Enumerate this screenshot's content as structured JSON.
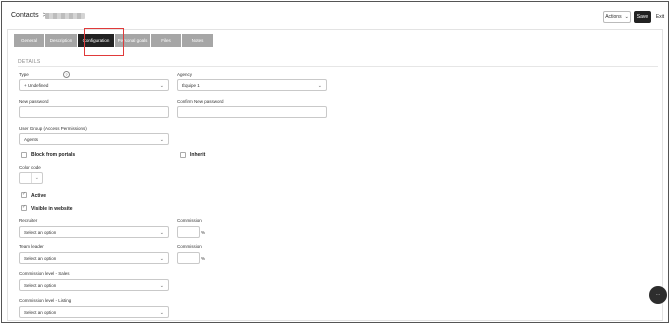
{
  "header": {
    "title": "Contacts",
    "separator": ">",
    "actions_label": "Actions",
    "save_label": "Save",
    "exit_label": "Exit"
  },
  "tabs": [
    {
      "label": "General"
    },
    {
      "label": "Description"
    },
    {
      "label": "Configuration",
      "active": true
    },
    {
      "label": "Personal goals"
    },
    {
      "label": "Files"
    },
    {
      "label": "Notes"
    }
  ],
  "section": {
    "title": "DETAILS"
  },
  "fields": {
    "type": {
      "label": "Type",
      "value": "+ Undefined"
    },
    "agency": {
      "label": "Agency",
      "value": "Équipe 1"
    },
    "new_password": {
      "label": "New password",
      "value": ""
    },
    "confirm_password": {
      "label": "Confirm New password",
      "value": ""
    },
    "user_group": {
      "label": "User Group (Access Permissions)",
      "value": "Agents"
    },
    "block_portals": {
      "label": "Block from portals",
      "checked": false
    },
    "inherit": {
      "label": "Inherit",
      "checked": false
    },
    "color_code": {
      "label": "Color code"
    },
    "active": {
      "label": "Active",
      "checked": true
    },
    "visible_website": {
      "label": "Visible in website",
      "checked": true
    },
    "recruiter": {
      "label": "Recruiter",
      "value": "Select an option"
    },
    "recruiter_commission": {
      "label": "Commission",
      "value": "",
      "suffix": "%"
    },
    "team_leader": {
      "label": "Team leader",
      "value": "Select an option"
    },
    "team_commission": {
      "label": "Commission",
      "value": "",
      "suffix": "%"
    },
    "commission_sales": {
      "label": "Commission level - Sales",
      "value": "Select an option"
    },
    "commission_listing": {
      "label": "Commission level - Listing",
      "value": "Select an option"
    }
  },
  "icons": {
    "help": "?",
    "chevron": "⌄",
    "check": "✓",
    "fab": "⋯"
  }
}
